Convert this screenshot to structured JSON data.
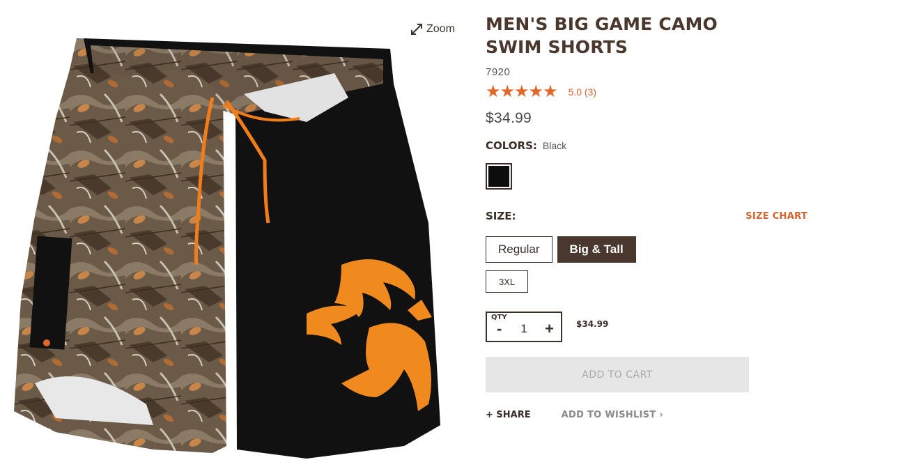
{
  "zoom": {
    "label": "Zoom",
    "icon": "expand-arrows-icon"
  },
  "product": {
    "title": "MEN'S BIG GAME CAMO SWIM SHORTS",
    "sku": "7920",
    "rating_stars": "★★★★★",
    "rating_text": "5.0  (3)",
    "price": "$34.99"
  },
  "colors": {
    "label": "COLORS:",
    "selected": "Black",
    "swatch_color": "#0d0d0d"
  },
  "size": {
    "label": "SIZE:",
    "chart_link": "SIZE CHART",
    "groups": [
      "Regular",
      "Big & Tall"
    ],
    "selected_group": "Big & Tall",
    "values": [
      "3XL"
    ]
  },
  "quantity": {
    "label": "QTY",
    "minus": "-",
    "value": "1",
    "plus": "+",
    "line_price": "$34.99"
  },
  "add_to_cart": "ADD TO CART",
  "actions": {
    "share": "+ SHARE",
    "wishlist": "ADD TO WISHLIST ›"
  },
  "theme": {
    "accent": "#e0662a",
    "brand_brown": "#4a372d",
    "disabled_bg": "#e6e6e6"
  }
}
